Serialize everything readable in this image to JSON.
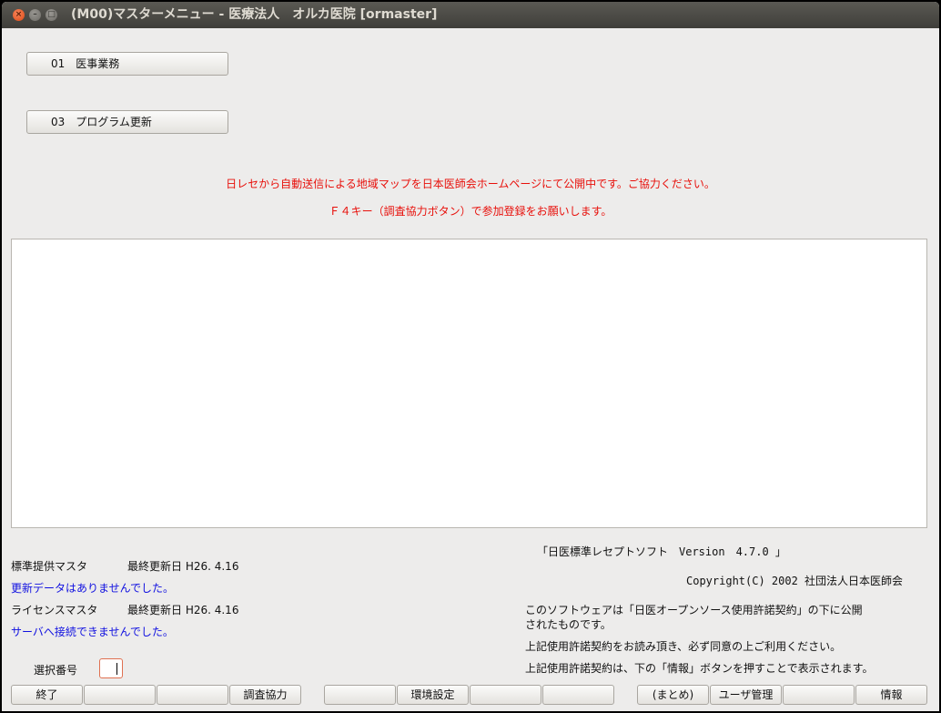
{
  "window": {
    "title": "(M00)マスターメニュー - 医療法人　オルカ医院  [ormaster]",
    "close_glyph": "×",
    "min_glyph": "–",
    "max_glyph": "□"
  },
  "menu": {
    "items": [
      {
        "label": "01　医事業務"
      },
      {
        "label": "03　プログラム更新"
      }
    ]
  },
  "notice": {
    "line1": "日レセから自動送信による地域マップを日本医師会ホームページにて公開中です。ご協力ください。",
    "line2": "Ｆ４キー（調査協力ボタン）で参加登録をお願いします。"
  },
  "status": {
    "std_master_label": "標準提供マスタ",
    "std_master_updated": "最終更新日 H26. 4.16",
    "std_master_msg": "更新データはありませんでした。",
    "license_master_label": "ライセンスマスタ",
    "license_master_updated": "最終更新日 H26. 4.16",
    "license_master_msg": "サーバへ接続できませんでした。"
  },
  "about": {
    "version": "「日医標準レセプトソフト　Version　4.7.0 」",
    "copyright": "Copyright(C) 2002 社団法人日本医師会",
    "license_line1": "このソフトウェアは「日医オープンソース使用許諾契約」の下に公開",
    "license_line2": "されたものです。",
    "license_line3": "上記使用許諾契約をお読み頂き、必ず同意の上ご利用ください。",
    "license_line4": "上記使用許諾契約は、下の「情報」ボタンを押すことで表示されます。"
  },
  "selection": {
    "label": "選択番号",
    "value": ""
  },
  "fkeys": [
    {
      "label": "終了"
    },
    {
      "label": ""
    },
    {
      "label": ""
    },
    {
      "label": "調査協力"
    },
    {
      "label": ""
    },
    {
      "label": "環境設定"
    },
    {
      "label": ""
    },
    {
      "label": ""
    },
    {
      "label": "(まとめ)"
    },
    {
      "label": "ユーザ管理"
    },
    {
      "label": ""
    },
    {
      "label": "情報"
    }
  ]
}
